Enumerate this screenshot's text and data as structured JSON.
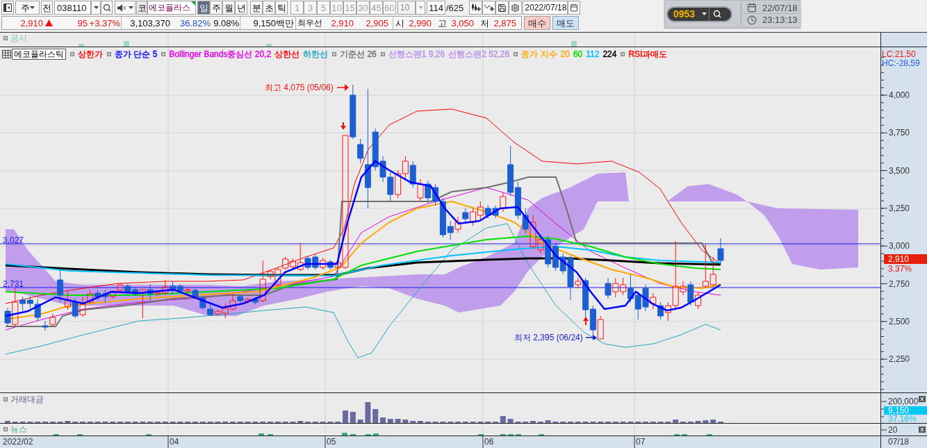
{
  "toolbar": {
    "market_select": {
      "value": "주"
    },
    "prev_button": "전",
    "code_field": {
      "value": "038110"
    },
    "market_badge": "코",
    "name_field": {
      "value": "에코플라스"
    },
    "period_groups": [
      {
        "items": [
          {
            "label": "일",
            "selected": true
          },
          {
            "label": "주",
            "selected": false
          },
          {
            "label": "월",
            "selected": false
          },
          {
            "label": "년",
            "selected": false
          }
        ]
      },
      {
        "items": [
          {
            "label": "분",
            "selected": false
          },
          {
            "label": "초",
            "selected": false
          },
          {
            "label": "틱",
            "selected": false
          }
        ]
      }
    ],
    "intervals": [
      {
        "label": "1",
        "disabled": true
      },
      {
        "label": "3",
        "disabled": true
      },
      {
        "label": "5",
        "disabled": true
      },
      {
        "label": "10",
        "disabled": true
      },
      {
        "label": "15",
        "disabled": true
      },
      {
        "label": "30",
        "disabled": true
      },
      {
        "label": "45",
        "disabled": true
      },
      {
        "label": "60",
        "disabled": true
      }
    ],
    "interval_field": {
      "value": "10",
      "disabled": true
    },
    "count_field": {
      "value": "114"
    },
    "count_total": "/625",
    "date_field": {
      "value": "2022/07/18"
    }
  },
  "quote": {
    "price": "2,910",
    "rising": true,
    "change": "95",
    "change_rate": "+3.37%",
    "volume": "3,103,370",
    "volume_ratio": "36.82%",
    "turnover": "9.08%",
    "trading_value": "9,150백만",
    "best_label": "최우선",
    "best_ask": "2,910",
    "best_bid": "2,905",
    "ohlc": [
      {
        "label": "시",
        "value": "2,990"
      },
      {
        "label": "고",
        "value": "3,050"
      },
      {
        "label": "저",
        "value": "2,875"
      }
    ],
    "buttons": [
      {
        "label": "매수",
        "kind": "buy"
      },
      {
        "label": "매도",
        "kind": "sell"
      }
    ]
  },
  "screen_panel": {
    "screen_number": "0953",
    "date": "22/07/18",
    "time": "23:13:13"
  },
  "chart": {
    "disclosure_pane": {
      "title": "공시"
    },
    "price_pane": {
      "stock_name": "에코플라스틱",
      "legend": [
        {
          "items": [
            {
              "text": "상한가",
              "color": "#ff0000"
            }
          ]
        },
        {
          "items": [
            {
              "text": "종가 단순 5",
              "color": "#0000ff"
            }
          ]
        },
        {
          "items": [
            {
              "text": "Bollinger Bands중심선 20,2",
              "color": "#e000e0"
            },
            {
              "text": "상한선",
              "color": "#ff0000"
            },
            {
              "text": "하한선",
              "color": "#1ea8c0"
            }
          ]
        },
        {
          "items": [
            {
              "text": "기준선 26",
              "color": "#707070"
            }
          ]
        },
        {
          "items": [
            {
              "text": "선행스팬1 9,26",
              "color": "#b890ec"
            },
            {
              "text": "선행스팬2 52,26",
              "color": "#b890ec"
            }
          ]
        },
        {
          "items": [
            {
              "text": "종가 지수",
              "color": "#ffa800"
            },
            {
              "text": "20",
              "color": "#ffa800"
            },
            {
              "text": "60",
              "color": "#00e000"
            },
            {
              "text": "112",
              "color": "#00c0ff"
            },
            {
              "text": "224",
              "color": "#000000"
            }
          ]
        },
        {
          "items": [
            {
              "text": "RSI과매도",
              "color": "#ff0000"
            }
          ]
        }
      ],
      "y_labels": [
        "4,000",
        "3,750",
        "3,500",
        "3,250",
        "3,000",
        "2,750",
        "2,500",
        "2,250"
      ],
      "lc": "LC:21,50",
      "hc": "HC:-28,59",
      "last_price": "2,910",
      "last_change": "3.37%",
      "levels": [
        "3,027",
        "2,731"
      ],
      "high_note": "최고 4,075 (05/06)",
      "low_note": "최저 2,395 (06/24)"
    },
    "value_pane": {
      "title": "거래대금",
      "y_label": "200,000",
      "last_value": "9,150",
      "last_ratio": "37.16%"
    },
    "news_pane": {
      "title": "뉴스",
      "y_label": "20"
    },
    "date_axis": {
      "labels": [
        "2022/02",
        "04",
        "05",
        "06",
        "07"
      ],
      "cursor_date": "07/18"
    }
  }
}
